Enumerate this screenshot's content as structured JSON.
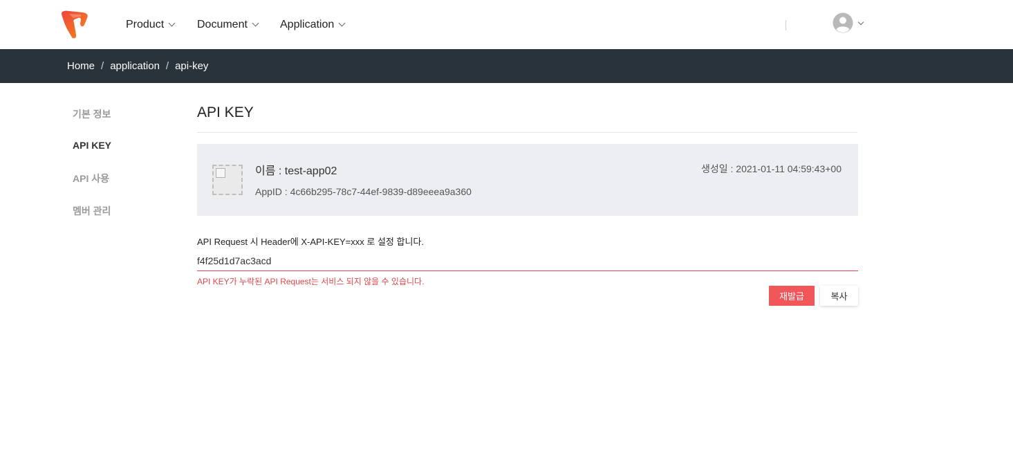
{
  "header": {
    "nav": [
      {
        "label": "Product"
      },
      {
        "label": "Document"
      },
      {
        "label": "Application"
      }
    ]
  },
  "breadcrumb": [
    "Home",
    "application",
    "api-key"
  ],
  "sidebar": {
    "items": [
      {
        "label": "기본 정보",
        "active": false
      },
      {
        "label": "API KEY",
        "active": true
      },
      {
        "label": "API 사용",
        "active": false
      },
      {
        "label": "멤버 관리",
        "active": false
      }
    ]
  },
  "main": {
    "title": "API KEY",
    "app": {
      "name": "이름 : test-app02",
      "app_id": "AppID : 4c66b295-78c7-44ef-9839-d89eeea9a360",
      "created": "생성일 : 2021-01-11 04:59:43+00"
    },
    "instruction": "API Request 시 Header에 X-API-KEY=xxx 로 설정 합니다.",
    "api_key_value": "f4f25d1d7ac3acd",
    "warning": "API KEY가 누락된 API Request는 서비스 되지 않을 수 있습니다.",
    "buttons": {
      "reissue": "재발급",
      "copy": "복사"
    }
  },
  "colors": {
    "breadcrumb_bg": "#28333b",
    "accent_red": "#f0565a",
    "error_red": "#e0474b",
    "card_bg": "#eceef2"
  }
}
